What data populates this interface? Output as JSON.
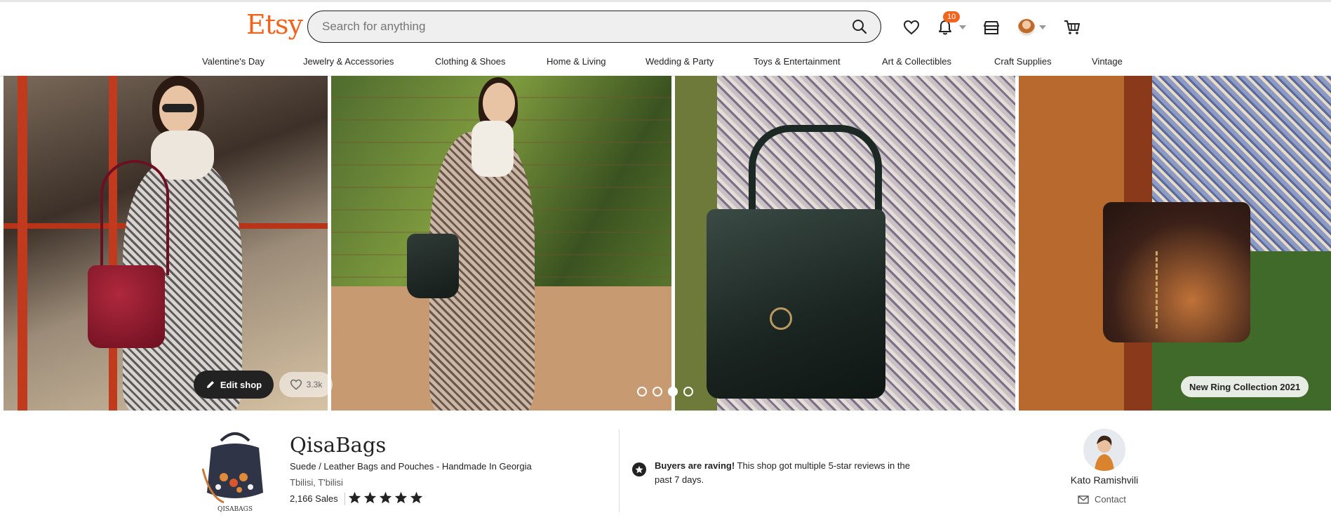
{
  "header": {
    "logo": "Etsy",
    "search_placeholder": "Search for anything",
    "notification_count": "10"
  },
  "categories": [
    "Valentine's Day",
    "Jewelry & Accessories",
    "Clothing & Shoes",
    "Home & Living",
    "Wedding & Party",
    "Toys & Entertainment",
    "Art & Collectibles",
    "Craft Supplies",
    "Vintage"
  ],
  "banner": {
    "edit_label": "Edit shop",
    "favorites_count": "3.3k",
    "collection_label": "New Ring Collection 2021",
    "slides_total": 4,
    "active_slide": 3
  },
  "shop": {
    "logo_text": "QISABAGS",
    "name": "QisaBags",
    "tagline": "Suede / Leather Bags and Pouches - Handmade In Georgia",
    "location": "Tbilisi, T'bilisi",
    "sales": "2,166 Sales",
    "rating": 5
  },
  "rave": {
    "bold": "Buyers are raving!",
    "text": " This shop got multiple 5-star reviews in the past 7 days."
  },
  "owner": {
    "name": "Kato Ramishvili",
    "contact_label": "Contact"
  },
  "colors": {
    "brand": "#f1641e",
    "badge": "#f1641e",
    "text": "#222222"
  }
}
